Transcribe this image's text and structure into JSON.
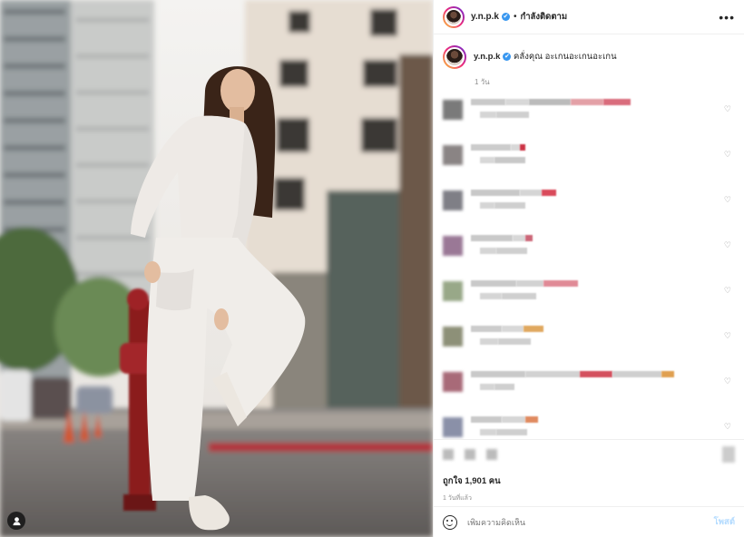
{
  "header": {
    "username": "y.n.p.k",
    "verified_mark": "✔",
    "separator": "•",
    "follow_status": "กำลังติดตาม",
    "more_icon": "more-icon"
  },
  "caption": {
    "username": "y.n.p.k",
    "text": "คลั่งคุณ อะเกนอะเกนอะเกน",
    "time": "1 วัน"
  },
  "comments": [
    {
      "avatar": "#7a7a7a",
      "heart": "♡",
      "line1": [
        [
          "#c9c9c9",
          38
        ],
        [
          "#d8d8d8",
          26
        ],
        [
          "#bbbbbb",
          46
        ],
        [
          "#e3a0a6",
          36
        ],
        [
          "#d96c7c",
          30
        ]
      ],
      "line2": [
        [
          "#d5d5d5",
          18
        ],
        [
          "#cfcfcf",
          36
        ]
      ]
    },
    {
      "avatar": "#8a8484",
      "heart": "♡",
      "line1": [
        [
          "#cccccc",
          44
        ],
        [
          "#d8d8d8",
          10
        ],
        [
          "#cc3344",
          6
        ]
      ],
      "line2": [
        [
          "#d8d8d8",
          16
        ],
        [
          "#c8c8c8",
          34
        ]
      ]
    },
    {
      "avatar": "#7f7f86",
      "heart": "♡",
      "line1": [
        [
          "#c8c8c8",
          54
        ],
        [
          "#d5d5d5",
          24
        ],
        [
          "#d94a5a",
          16
        ]
      ],
      "line2": [
        [
          "#d5d5d5",
          16
        ],
        [
          "#cfcfcf",
          34
        ]
      ]
    },
    {
      "avatar": "#9a7896",
      "heart": "♡",
      "line1": [
        [
          "#c9c9c9",
          46
        ],
        [
          "#d8d8d8",
          14
        ],
        [
          "#cc6677",
          8
        ]
      ],
      "line2": [
        [
          "#d5d5d5",
          18
        ],
        [
          "#cfcfcf",
          34
        ]
      ]
    },
    {
      "avatar": "#98a888",
      "heart": "♡",
      "line1": [
        [
          "#c9c9c9",
          50
        ],
        [
          "#d2d2d2",
          30
        ],
        [
          "#e08a96",
          38
        ]
      ],
      "line2": [
        [
          "#d5d5d5",
          24
        ],
        [
          "#cfcfcf",
          38
        ]
      ]
    },
    {
      "avatar": "#8d9078",
      "heart": "♡",
      "line1": [
        [
          "#cccccc",
          34
        ],
        [
          "#d8d8d8",
          24
        ],
        [
          "#e0a860",
          22
        ]
      ],
      "line2": [
        [
          "#d5d5d5",
          20
        ],
        [
          "#cfcfcf",
          36
        ]
      ]
    },
    {
      "avatar": "#a86a78",
      "heart": "♡",
      "line1": [
        [
          "#c9c9c9",
          60
        ],
        [
          "#d2d2d2",
          60
        ],
        [
          "#d4505e",
          36
        ],
        [
          "#cfcfcf",
          54
        ],
        [
          "#e0a050",
          14
        ]
      ],
      "line2": [
        [
          "#d5d5d5",
          16
        ],
        [
          "#cfcfcf",
          22
        ]
      ]
    },
    {
      "avatar": "#8a90a8",
      "heart": "♡",
      "line1": [
        [
          "#c9c9c9",
          34
        ],
        [
          "#d6d6d6",
          26
        ],
        [
          "#e08a60",
          14
        ]
      ],
      "line2": [
        [
          "#d5d5d5",
          18
        ],
        [
          "#cfcfcf",
          34
        ]
      ]
    }
  ],
  "footer": {
    "likes": "ถูกใจ 1,901 คน",
    "ago": "1 วันที่แล้ว"
  },
  "add_comment": {
    "placeholder": "เพิ่มความคิดเห็น",
    "post_label": "โพสต์",
    "emoji_icon": "emoji-icon"
  },
  "colors": {
    "accent": "#3897f0",
    "post_disabled": "#b3dbff",
    "text": "#262626",
    "muted": "#8e8e8e"
  }
}
